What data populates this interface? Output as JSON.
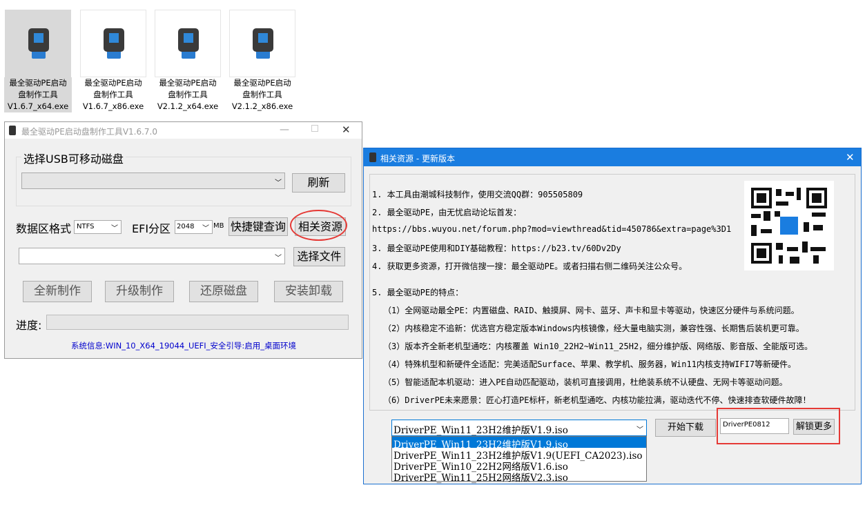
{
  "files": [
    {
      "l1": "最全驱动PE启动",
      "l2": "盘制作工具",
      "l3": "V1.6.7_x64.exe"
    },
    {
      "l1": "最全驱动PE启动",
      "l2": "盘制作工具",
      "l3": "V1.6.7_x86.exe"
    },
    {
      "l1": "最全驱动PE启动",
      "l2": "盘制作工具",
      "l3": "V2.1.2_x64.exe"
    },
    {
      "l1": "最全驱动PE启动",
      "l2": "盘制作工具",
      "l3": "V2.1.2_x86.exe"
    }
  ],
  "main": {
    "title": "最全驱动PE启动盘制作工具V1.6.7.0",
    "group": "选择USB可移动磁盘",
    "refresh": "刷新",
    "fmt_label": "数据区格式",
    "fmt_value": "NTFS",
    "efi_label": "EFI分区",
    "efi_value": "2048",
    "mb": "MB",
    "shortcut": "快捷键查询",
    "resources": "相关资源",
    "choose_file": "选择文件",
    "b1": "全新制作",
    "b2": "升级制作",
    "b3": "还原磁盘",
    "b4": "安装卸载",
    "progress": "进度:",
    "sysinfo": "系统信息:WIN_10_X64_19044_UEFI_安全引导:启用_桌面环境"
  },
  "res": {
    "title": "相关资源 - 更新版本",
    "close": "✕",
    "lines": [
      "1. 本工具由潮城科技制作，使用交流QQ群：905505809",
      "2. 最全驱动PE，由无忧启动论坛首发：",
      "https://bbs.wuyou.net/forum.php?mod=viewthread&tid=450786&extra=page%3D1",
      "3. 最全驱动PE使用和DIY基础教程：https://b23.tv/60Dv2Dy",
      "4. 获取更多资源，打开微信搜一搜：最全驱动PE。或者扫描右侧二维码关注公众号。",
      "5. 最全驱动PE的特点：",
      "（1）全网驱动最全PE：内置磁盘、RAID、触摸屏、网卡、蓝牙、声卡和显卡等驱动，快速区分硬件与系统问题。",
      "（2）内核稳定不追新：优选官方稳定版本Windows内核镜像，经大量电脑实测，兼容性强、长期售后装机更可靠。",
      "（3）版本齐全新老机型通吃：内核覆盖 Win10_22H2~Win11_25H2，细分维护版、网络版、影音版、全能版可选。",
      "（4）特殊机型和新硬件全适配：完美适配Surface、苹果、教学机、服务器，Win11内核支持WIFI7等新硬件。",
      "（5）智能适配本机驱动：进入PE自动匹配驱动，装机可直接调用，杜绝装系统不认硬盘、无网卡等驱动问题。",
      "（6）DriverPE未来愿景：匠心打造PE标杆，新老机型通吃、内核功能拉满，驱动迭代不停、快速排查软硬件故障！"
    ],
    "selected": "DriverPE_Win11_23H2维护版V1.9.iso",
    "options": [
      "DriverPE_Win11_23H2维护版V1.9.iso",
      "DriverPE_Win11_23H2维护版V1.9(UEFI_CA2023).iso",
      "DriverPE_Win10_22H2网络版V1.6.iso",
      "DriverPE_Win11_25H2网络版V2.3.iso"
    ],
    "download": "开始下载",
    "code": "DriverPE0812",
    "unlock": "解锁更多"
  }
}
